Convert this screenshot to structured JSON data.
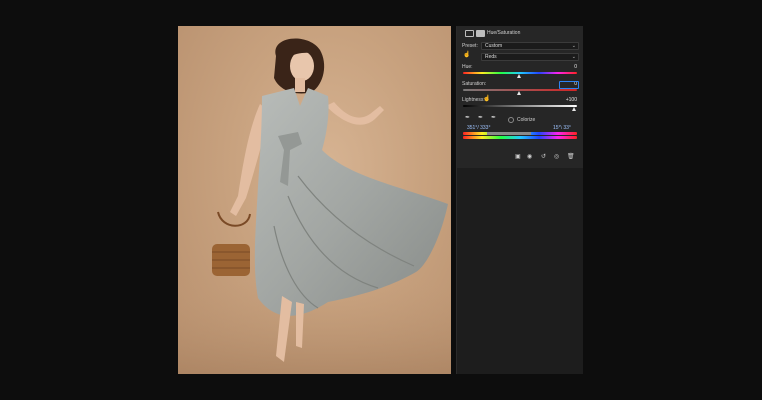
{
  "panel": {
    "title": "Hue/Saturation",
    "preset": {
      "label": "Preset:",
      "value": "Custom"
    },
    "channel": {
      "value": "Reds"
    },
    "hue": {
      "label": "Hue:",
      "value": "0",
      "level": 0.5
    },
    "saturation": {
      "label": "Saturation:",
      "value": "0",
      "level": 0.5
    },
    "lightness": {
      "label": "Lightness:",
      "value": "+100",
      "level": 1.0
    },
    "colorize": {
      "label": "Colorize",
      "checked": false
    },
    "range_left": "351°/ 333°",
    "range_right": "15°\\ 33°",
    "bottom_icons": [
      "clip-to-layer-icon",
      "view-previous-icon",
      "reset-icon",
      "visibility-icon",
      "delete-icon"
    ]
  },
  "colors": {
    "accent": "#2f83f2",
    "backdrop": "#c8a27f",
    "dress": "#a6aaa7"
  }
}
